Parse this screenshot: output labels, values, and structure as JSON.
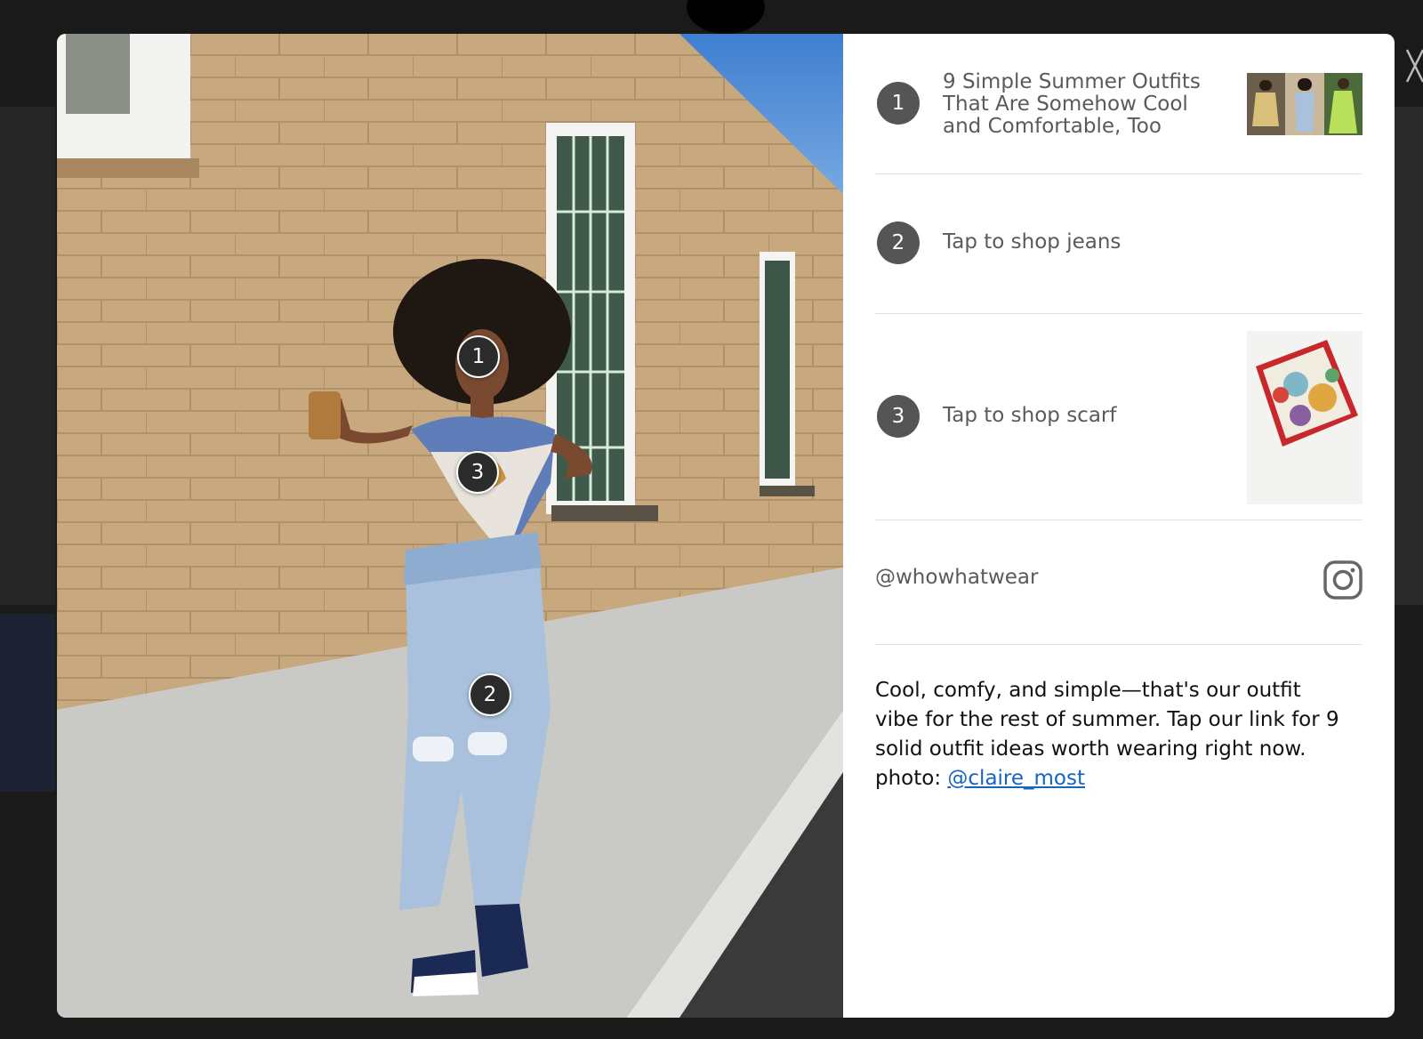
{
  "colors": {
    "overlay": "#1a1a1a",
    "modal_bg": "#ffffff",
    "hotspot_bg": "#2b2b2b",
    "panel_number_bg": "#555555",
    "panel_text": "#5a5a5a",
    "link": "#1565c0"
  },
  "hotspots": [
    {
      "label": "1"
    },
    {
      "label": "3"
    },
    {
      "label": "2"
    }
  ],
  "panel": {
    "items": [
      {
        "number": "1",
        "text": "9 Simple Summer Outfits That Are Somehow Cool and Comfortable, Too",
        "thumbnail": "outfit-collage-thumbnail"
      },
      {
        "number": "2",
        "text": "Tap to shop jeans"
      },
      {
        "number": "3",
        "text": "Tap to shop scarf",
        "thumbnail": "scarf-product-thumbnail"
      }
    ],
    "handle": "@whowhatwear",
    "handle_icon": "instagram-icon",
    "caption": {
      "text": "Cool, comfy, and simple—that's our outfit vibe for the rest of summer. Tap our link for 9 solid outfit ideas worth wearing right now. photo: ",
      "link": "@claire_most"
    }
  },
  "close_icon": "close-icon"
}
